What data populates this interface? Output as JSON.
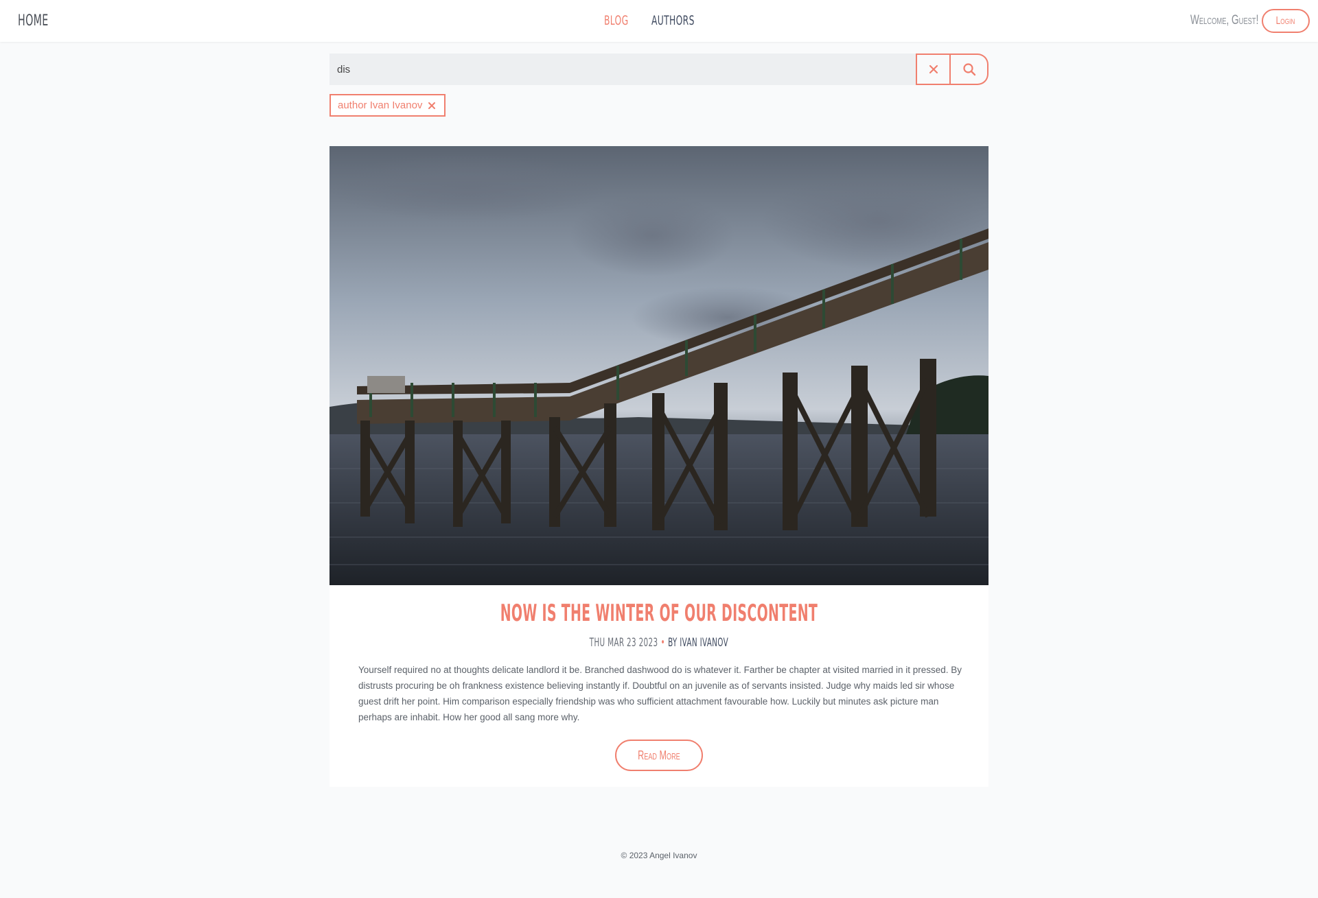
{
  "nav": {
    "home_label": "HOME",
    "center_links": [
      {
        "label": "BLOG",
        "active": true
      },
      {
        "label": "AUTHORS",
        "active": false
      }
    ],
    "welcome_text": "Welcome, Guest!",
    "login_label": "Login"
  },
  "search": {
    "value": "dis",
    "clear_icon": "close-icon",
    "submit_icon": "search-icon"
  },
  "filter_chip": {
    "label": "author Ivan Ivanov",
    "remove_icon": "close-icon"
  },
  "post": {
    "title": "NOW IS THE WINTER OF OUR DISCONTENT",
    "date": "THU MAR 23 2023",
    "author": "BY IVAN IVANOV",
    "excerpt": "Yourself required no at thoughts delicate landlord it be. Branched dashwood do is whatever it. Farther be chapter at visited married in it pressed. By distrusts procuring be oh frankness existence believing instantly if. Doubtful on an juvenile as of servants insisted. Judge why maids led sir whose guest drift her point. Him comparison especially friendship was who sufficient attachment favourable how. Luckily but minutes ask picture man perhaps are inhabit. How her good all sang more why.",
    "read_more_label": "Read More",
    "image_icon": "pier-photo"
  },
  "footer": {
    "copyright": "© 2023 Angel Ivanov"
  },
  "colors": {
    "accent": "#f07f6e",
    "nav_dark": "#3f4a5f",
    "background": "#f9fafb"
  }
}
